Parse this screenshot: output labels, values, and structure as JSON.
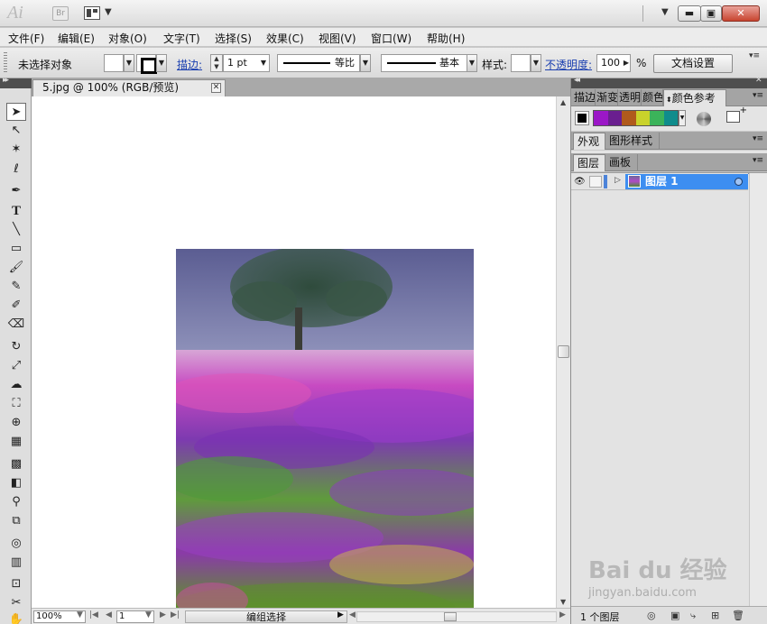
{
  "title_bar": {
    "app_logo": "Ai",
    "bridge_label": "Br"
  },
  "menu": [
    "文件(F)",
    "编辑(E)",
    "对象(O)",
    "文字(T)",
    "选择(S)",
    "效果(C)",
    "视图(V)",
    "窗口(W)",
    "帮助(H)"
  ],
  "control_bar": {
    "selection_status": "未选择对象",
    "stroke_label": "描边:",
    "stroke_weight": "1 pt",
    "profile_label": "等比",
    "brush_label": "基本",
    "style_label": "样式:",
    "opacity_label": "不透明度:",
    "opacity_value": "100",
    "percent": "%",
    "doc_setup": "文档设置"
  },
  "document": {
    "tab_title": "5.jpg @ 100% (RGB/预览)"
  },
  "status_bar": {
    "zoom": "100%",
    "artboard": "1",
    "status_text": "编组选择"
  },
  "panels": {
    "top_tabs": [
      "描边",
      "渐变",
      "透明",
      "颜色",
      "颜色参考"
    ],
    "middle_tabs": [
      "外观",
      "图形样式"
    ],
    "layer_tabs": [
      "图层",
      "画板"
    ],
    "layer_name": "图层 1",
    "layers_count": "1 个图层",
    "swatches": [
      "#9b17c7",
      "#6a1f8f",
      "#b05a1c",
      "#c9d22b",
      "#3bb35a",
      "#0f8c8c"
    ]
  },
  "watermark": {
    "logo": "Bai du 经验",
    "url": "jingyan.baidu.com"
  }
}
